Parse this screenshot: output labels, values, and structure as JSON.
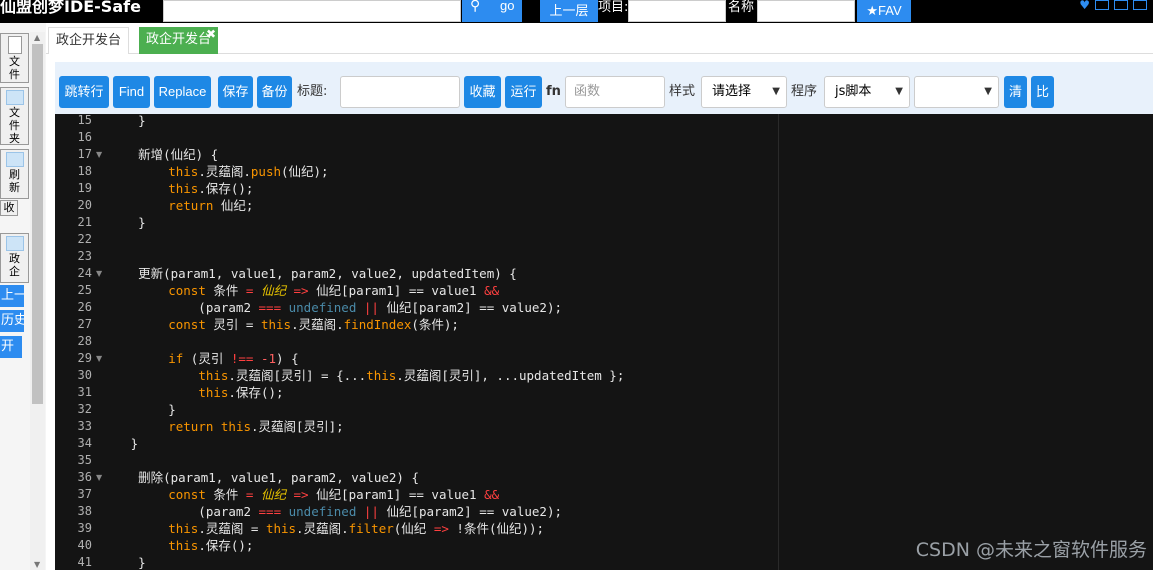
{
  "topbar": {
    "title": "仙盟创梦IDE-Safe",
    "go_label": "go",
    "up_label": "上一层",
    "label_project": "项目:",
    "label_name": "名称",
    "fav_label": "★FAV"
  },
  "sidebar": {
    "items": [
      {
        "label": "文件"
      },
      {
        "label": "文件夹"
      },
      {
        "label": "刷新"
      },
      {
        "label": "收"
      },
      {
        "label": "政企"
      },
      {
        "label": "上一"
      },
      {
        "label": "历史"
      },
      {
        "label": "开"
      }
    ]
  },
  "tabs": [
    {
      "label": "政企开发台"
    },
    {
      "label": "政企开发台",
      "close": "✖"
    }
  ],
  "toolbar": {
    "jump": "跳转行",
    "find": "Find",
    "replace": "Replace",
    "save": "保存",
    "backup": "备份",
    "title_label": "标题:",
    "collect": "收藏",
    "run": "运行",
    "fn_label": "fn",
    "fn_placeholder": "函数",
    "style_label": "样式",
    "style_value": "请选择",
    "program_label": "程序",
    "program_value": "js脚本",
    "clear": "清",
    "compare": "比"
  },
  "editor": {
    "line_numbers": [
      "15",
      "16",
      "17",
      "18",
      "19",
      "20",
      "21",
      "22",
      "23",
      "24",
      "25",
      "26",
      "27",
      "28",
      "29",
      "30",
      "31",
      "32",
      "33",
      "34",
      "35",
      "36",
      "37",
      "38",
      "39",
      "40",
      "41"
    ],
    "lines": [
      "    }",
      "",
      "    新增(仙纪) {",
      "        this.灵蕴阁.push(仙纪);",
      "        this.保存();",
      "        return 仙纪;",
      "    }",
      "",
      "",
      "    更新(param1, value1, param2, value2, updatedItem) {",
      "        const 条件 = 仙纪 => 仙纪[param1] == value1 &&",
      "            (param2 === undefined || 仙纪[param2] == value2);",
      "        const 灵引 = this.灵蕴阁.findIndex(条件);",
      "",
      "        if (灵引 !== -1) {",
      "            this.灵蕴阁[灵引] = {...this.灵蕴阁[灵引], ...updatedItem };",
      "            this.保存();",
      "        }",
      "        return this.灵蕴阁[灵引];",
      "   }",
      "",
      "    删除(param1, value1, param2, value2) {",
      "        const 条件 = 仙纪 => 仙纪[param1] == value1 &&",
      "            (param2 === undefined || 仙纪[param2] == value2);",
      "        this.灵蕴阁 = this.灵蕴阁.filter(仙纪 => !条件(仙纪));",
      "        this.保存();",
      "    }"
    ]
  },
  "watermark": "CSDN @未来之窗软件服务",
  "colors": {
    "accent": "#1e88e5",
    "tab_active": "#4caf50",
    "editor_bg": "#141414",
    "keyword": "#f99500"
  }
}
